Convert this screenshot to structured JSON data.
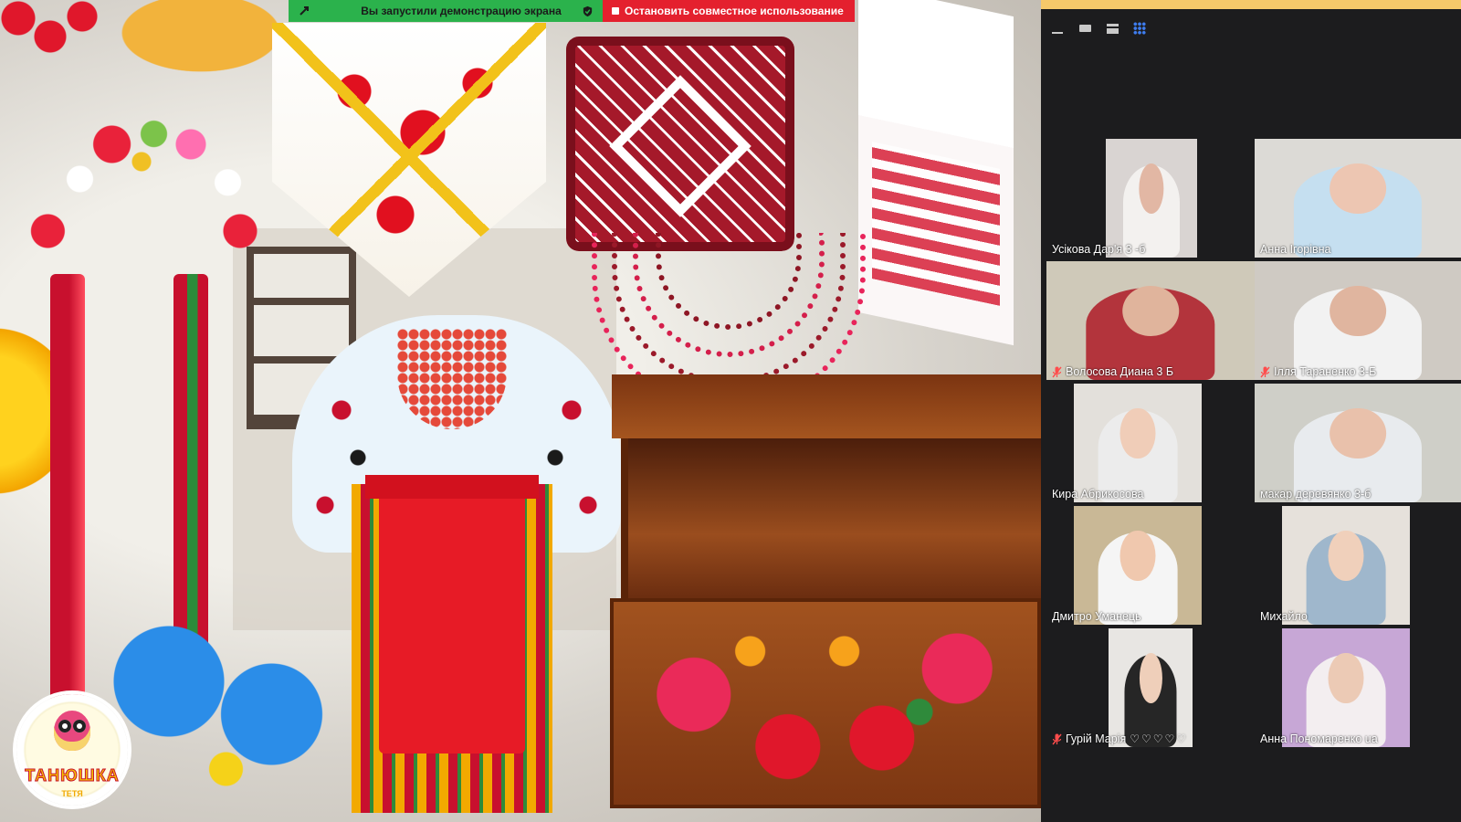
{
  "share_banner": {
    "status_text": "Вы запустили демонстрацию экрана",
    "stop_label": "Остановить совместное использование",
    "status_color": "#2bb24c",
    "stop_color": "#e4202e"
  },
  "slide": {
    "logo_name": "ТАНЮШКА",
    "logo_sub": "ТЕТЯ"
  },
  "panel": {
    "controls": [
      "minimize-icon",
      "single-view-icon",
      "speaker-view-icon",
      "gallery-view-icon"
    ],
    "participants": [
      {
        "name": "Усікова Дар'я 3 -б",
        "muted": false,
        "active": false,
        "bg": "#d9d4d2",
        "shirt": "#f3f1ef",
        "skin": "#e2b7a4",
        "frame": [
          65,
          165
        ]
      },
      {
        "name": "Анна Ігорівна",
        "muted": false,
        "active": false,
        "bg": "#dcdad6",
        "shirt": "#c5dff0",
        "skin": "#edc6b2",
        "frame": [
          0,
          226
        ]
      },
      {
        "name": "Волосова Диана 3 Б",
        "muted": true,
        "active": true,
        "bg": "#cfc9b9",
        "shirt": "#b3343c",
        "skin": "#e0b49c",
        "frame": [
          0,
          228
        ]
      },
      {
        "name": "Ілля Тараненко 3-Б",
        "muted": true,
        "active": false,
        "bg": "#cfcac3",
        "shirt": "#f2f2f2",
        "skin": "#e0b59f",
        "frame": [
          0,
          226
        ]
      },
      {
        "name": "Кира Абрикосова",
        "muted": false,
        "active": false,
        "bg": "#e3e0db",
        "shirt": "#ececec",
        "skin": "#f0cdb8",
        "frame": [
          30,
          170
        ]
      },
      {
        "name": "макар  деревянко 3-б",
        "muted": false,
        "active": false,
        "bg": "#cfcfc8",
        "shirt": "#e8ebee",
        "skin": "#e9c1ab",
        "frame": [
          0,
          226
        ]
      },
      {
        "name": "Дмитро Уманець",
        "muted": false,
        "active": false,
        "bg": "#c9b896",
        "shirt": "#f5f5f5",
        "skin": "#f0c8ae",
        "frame": [
          30,
          170
        ]
      },
      {
        "name": "Михайло",
        "muted": false,
        "active": false,
        "bg": "#e6e1db",
        "shirt": "#9fb7cc",
        "skin": "#f0d0bb",
        "frame": [
          30,
          170
        ]
      },
      {
        "name": "Гурій Марія",
        "muted": true,
        "active": false,
        "bg": "#e8e6e3",
        "shirt": "#262626",
        "skin": "#efcfba",
        "frame": [
          68,
          160
        ],
        "hearts": "♡♡♡♡♡"
      },
      {
        "name": "Анна Пономаренко ua",
        "muted": false,
        "active": false,
        "bg": "#c7a7d6",
        "shirt": "#f3eef0",
        "skin": "#eccab5",
        "frame": [
          30,
          170
        ]
      }
    ]
  }
}
